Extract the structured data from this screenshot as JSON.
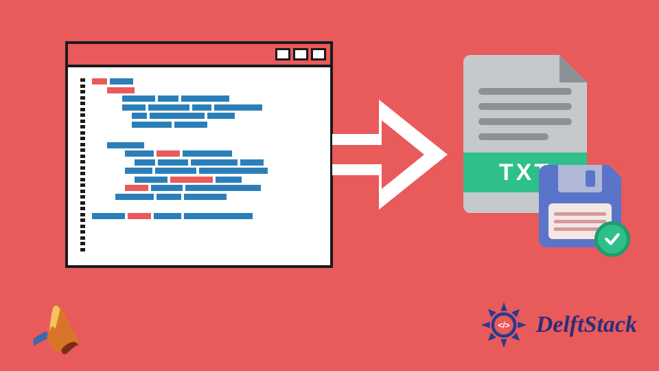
{
  "txt_label": "TXT",
  "brand_name": "DelftStack",
  "colors": {
    "bg": "#e95a5b",
    "window_border": "#1a1a1a",
    "code_blue": "#2b7fb8",
    "code_red": "#e95a5b",
    "doc_bg": "#c6c9cc",
    "doc_line": "#8c9196",
    "txt_band": "#2fbf8a",
    "floppy": "#5a74c9",
    "check": "#2fbf8a",
    "brand_text": "#2a2f7a"
  },
  "icons": {
    "matlab": "matlab-logo",
    "brand": "delftstack-logo",
    "check": "checkmark"
  }
}
